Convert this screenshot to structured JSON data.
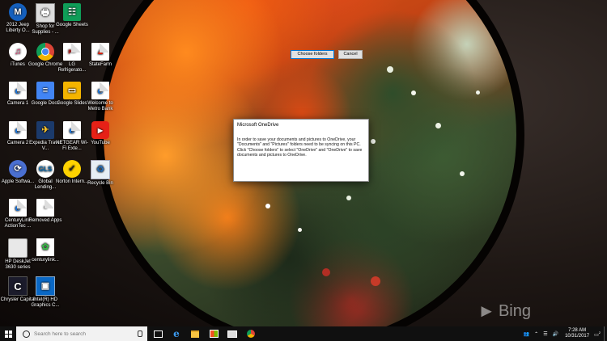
{
  "desktop": {
    "icons": [
      {
        "label": "2012 Jeep Liberty O...",
        "icon": "jeep-icon"
      },
      {
        "label": "Shop for Supplies - ...",
        "icon": "printer-shop-icon"
      },
      {
        "label": "Google Sheets",
        "icon": "google-sheets-icon"
      },
      {
        "label": "iTunes",
        "icon": "itunes-icon"
      },
      {
        "label": "Google Chrome",
        "icon": "chrome-icon"
      },
      {
        "label": "LG Refrigerato...",
        "icon": "pdf-file-icon"
      },
      {
        "label": "StateFarm",
        "icon": "statefarm-icon"
      },
      {
        "label": "Camera 1",
        "icon": "ie-shortcut-icon"
      },
      {
        "label": "Google Docs",
        "icon": "google-docs-icon"
      },
      {
        "label": "Google Slides",
        "icon": "google-slides-icon"
      },
      {
        "label": "Welcome to Metro Bank",
        "icon": "ie-shortcut-icon"
      },
      {
        "label": "Camera 2",
        "icon": "ie-shortcut-icon"
      },
      {
        "label": "Expedia Travel V...",
        "icon": "expedia-icon"
      },
      {
        "label": "NETGEAR Wi-Fi Exte...",
        "icon": "ie-shortcut-icon"
      },
      {
        "label": "YouTube",
        "icon": "youtube-icon"
      },
      {
        "label": "Apple Softwa...",
        "icon": "apple-software-icon"
      },
      {
        "label": "Global Lending...",
        "icon": "global-lending-icon"
      },
      {
        "label": "Norton Intern...",
        "icon": "norton-icon"
      },
      {
        "label": "Recycle Bin",
        "icon": "recycle-bin-icon"
      },
      {
        "label": "CenturyLink ActionTec ...",
        "icon": "ie-shortcut-icon"
      },
      {
        "label": "Removed Apps",
        "icon": "document-icon"
      },
      {
        "label": "HP DeskJet 3630 series",
        "icon": "hp-printer-icon"
      },
      {
        "label": "centurylink...",
        "icon": "centurylink-icon"
      },
      {
        "label": "Chrysler Capital",
        "icon": "chrysler-capital-icon"
      },
      {
        "label": "Intel(R) HD Graphics C...",
        "icon": "intel-graphics-icon"
      }
    ]
  },
  "dialog": {
    "title": "Microsoft OneDrive",
    "message": "In order to save your documents and pictures to OneDrive, your \"Documents\" and \"Pictures\" folders need to be syncing on this PC. Click \"Choose folders\" to select \"OneDrive\" and \"OneDrive\" to save documents and pictures to OneDrive.",
    "primary_button": "Choose folders",
    "cancel_button": "Cancel"
  },
  "wallpaper": {
    "watermark": "Bing"
  },
  "taskbar": {
    "search_placeholder": "Search here to search",
    "pinned": [
      "task-view-icon",
      "edge-icon",
      "file-explorer-icon",
      "store-icon",
      "mail-icon",
      "chrome-icon"
    ],
    "clock_time": "7:28 AM",
    "clock_date": "10/31/2017",
    "notification_count": "2"
  },
  "colors": {
    "taskbar": "#101010",
    "accent": "#0078d7"
  }
}
